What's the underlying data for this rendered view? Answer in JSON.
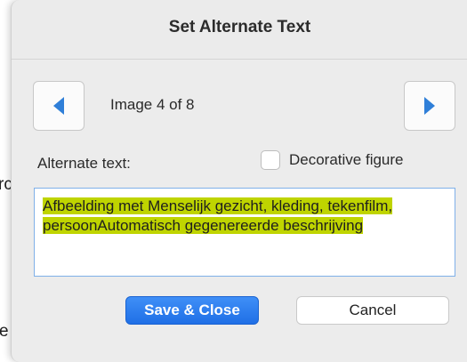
{
  "background": {
    "fragment_1": "rc",
    "fragment_2": "e"
  },
  "dialog": {
    "title": "Set Alternate Text",
    "navigation": {
      "prev_icon": "triangle-left-icon",
      "next_icon": "triangle-right-icon",
      "counter_text": "Image 4 of 8"
    },
    "alt_text_label": "Alternate text:",
    "decorative_checkbox": {
      "label": "Decorative figure",
      "checked": false
    },
    "alt_text_value": "Afbeelding met Menselijk gezicht, kleding, tekenfilm, persoonAutomatisch gegenereerde beschrijving",
    "buttons": {
      "save_close": "Save & Close",
      "cancel": "Cancel"
    },
    "colors": {
      "accent": "#2a7cf0",
      "selection": "#bfd400",
      "nav_arrow": "#2f7fd8"
    }
  }
}
